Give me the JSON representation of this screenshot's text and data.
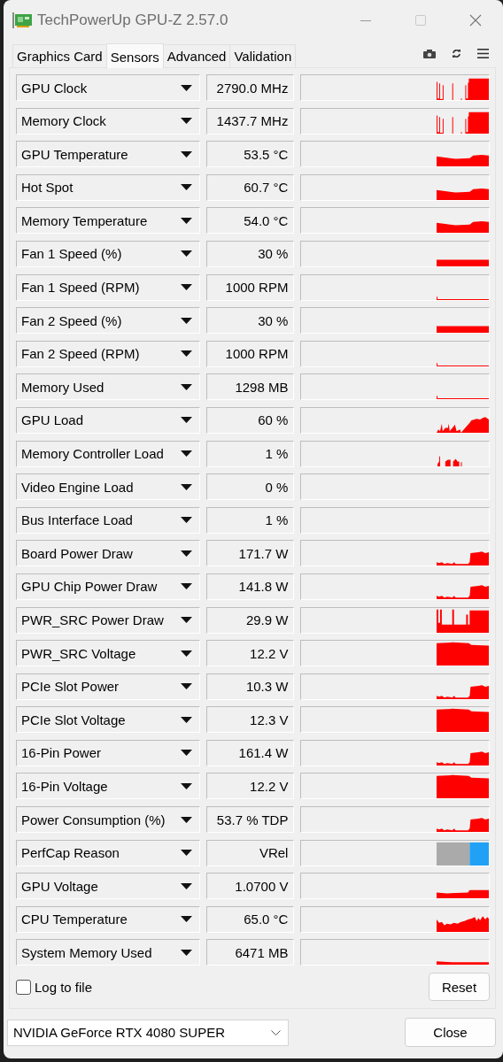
{
  "window": {
    "title": "TechPowerUp GPU-Z 2.57.0"
  },
  "tabs": [
    {
      "label": "Graphics Card",
      "selected": false
    },
    {
      "label": "Sensors",
      "selected": true
    },
    {
      "label": "Advanced",
      "selected": false
    },
    {
      "label": "Validation",
      "selected": false
    }
  ],
  "sensors": [
    {
      "name": "GPU Clock",
      "value": "2790.0 MHz",
      "kind": "spikes"
    },
    {
      "name": "Memory Clock",
      "value": "1437.7 MHz",
      "kind": "spikes"
    },
    {
      "name": "GPU Temperature",
      "value": "53.5 °C",
      "kind": "temp"
    },
    {
      "name": "Hot Spot",
      "value": "60.7 °C",
      "kind": "temp"
    },
    {
      "name": "Memory Temperature",
      "value": "54.0 °C",
      "kind": "temp"
    },
    {
      "name": "Fan 1 Speed (%)",
      "value": "30 %",
      "kind": "band"
    },
    {
      "name": "Fan 1 Speed (RPM)",
      "value": "1000 RPM",
      "kind": "line"
    },
    {
      "name": "Fan 2 Speed (%)",
      "value": "30 %",
      "kind": "band"
    },
    {
      "name": "Fan 2 Speed (RPM)",
      "value": "1000 RPM",
      "kind": "line"
    },
    {
      "name": "Memory Used",
      "value": "1298 MB",
      "kind": "line"
    },
    {
      "name": "GPU Load",
      "value": "60 %",
      "kind": "load"
    },
    {
      "name": "Memory Controller Load",
      "value": "1 %",
      "kind": "bursts"
    },
    {
      "name": "Video Engine Load",
      "value": "0 %",
      "kind": "empty"
    },
    {
      "name": "Bus Interface Load",
      "value": "1 %",
      "kind": "empty"
    },
    {
      "name": "Board Power Draw",
      "value": "171.7 W",
      "kind": "step"
    },
    {
      "name": "GPU Chip Power Draw",
      "value": "141.8 W",
      "kind": "step"
    },
    {
      "name": "PWR_SRC Power Draw",
      "value": "29.9 W",
      "kind": "spikyblock"
    },
    {
      "name": "PWR_SRC Voltage",
      "value": "12.2 V",
      "kind": "block"
    },
    {
      "name": "PCIe Slot Power",
      "value": "10.3 W",
      "kind": "step"
    },
    {
      "name": "PCIe Slot Voltage",
      "value": "12.3 V",
      "kind": "block"
    },
    {
      "name": "16-Pin Power",
      "value": "161.4 W",
      "kind": "step"
    },
    {
      "name": "16-Pin Voltage",
      "value": "12.2 V",
      "kind": "block"
    },
    {
      "name": "Power Consumption (%)",
      "value": "53.7 % TDP",
      "kind": "step"
    },
    {
      "name": "PerfCap Reason",
      "value": "VRel",
      "kind": "split"
    },
    {
      "name": "GPU Voltage",
      "value": "1.0700 V",
      "kind": "lowstep"
    },
    {
      "name": "CPU Temperature",
      "value": "65.0 °C",
      "kind": "noisy"
    },
    {
      "name": "System Memory Used",
      "value": "6471 MB",
      "kind": "thinband"
    }
  ],
  "log_to_file": {
    "label": "Log to file",
    "checked": false
  },
  "reset_button": "Reset",
  "gpu_select": {
    "value": "NVIDIA GeForce RTX 4080 SUPER"
  },
  "close_button": "Close"
}
